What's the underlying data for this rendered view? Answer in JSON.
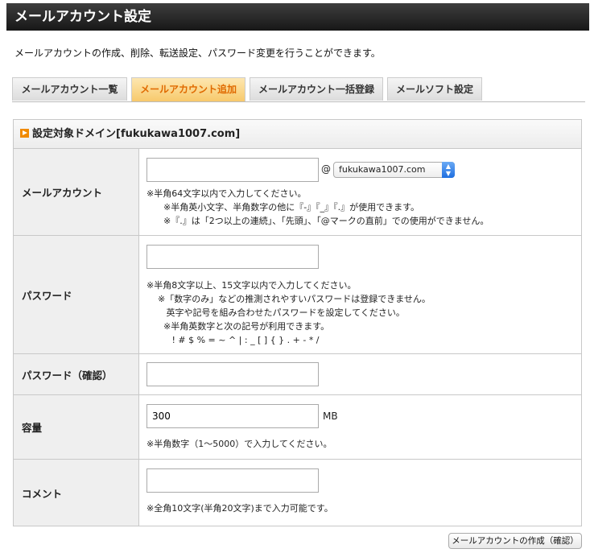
{
  "header": {
    "title": "メールアカウント設定"
  },
  "description": "メールアカウントの作成、削除、転送設定、パスワード変更を行うことができます。",
  "tabs": [
    {
      "label": "メールアカウント一覧",
      "active": false
    },
    {
      "label": "メールアカウント追加",
      "active": true
    },
    {
      "label": "メールアカウント一括登録",
      "active": false
    },
    {
      "label": "メールソフト設定",
      "active": false
    }
  ],
  "form": {
    "heading": "設定対象ドメイン[fukukawa1007.com]",
    "account": {
      "label": "メールアカウント",
      "value": "",
      "at": "@",
      "domain_selected": "fukukawa1007.com",
      "note": "※半角64文字以内で入力してください。\n      ※半角英小文字、半角数字の他に『-』『_』『.』が使用できます。\n      ※『.』は「2つ以上の連続」、「先頭」、「@マークの直前」での使用ができません。"
    },
    "password": {
      "label": "パスワード",
      "value": "",
      "note": "※半角8文字以上、15文字以内で入力してください。\n    ※「数字のみ」などの推測されやすいパスワードは登録できません。\n       英字や記号を組み合わせたパスワードを設定してください。\n      ※半角英数字と次の記号が利用できます。\n         ! # $ % = ~ ^ | : _ [ ] { } . + - * /"
    },
    "password_confirm": {
      "label": "パスワード（確認）",
      "value": ""
    },
    "capacity": {
      "label": "容量",
      "value": "300",
      "unit": "MB",
      "note": "※半角数字（1〜5000）で入力してください。"
    },
    "comment": {
      "label": "コメント",
      "value": "",
      "note": "※全角10文字(半角20文字)まで入力可能です。"
    },
    "submit_label": "メールアカウントの作成（確認）"
  },
  "colors": {
    "tab_active_text": "#e06a00",
    "accent": "#f08a00"
  }
}
